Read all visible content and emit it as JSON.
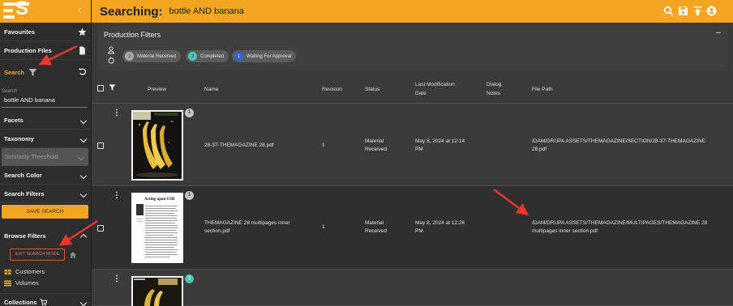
{
  "app": {
    "logo_text": "ES",
    "collapse_glyph": "‹"
  },
  "header": {
    "title": "Searching:",
    "query": "bottle AND banana",
    "icons": [
      "search-icon",
      "save-icon",
      "upload-icon",
      "user-icon"
    ]
  },
  "sidebar": {
    "favourites": "Favourites",
    "production_files": "Production Files",
    "search": "Search",
    "search_field_label": "Search",
    "search_value": "bottle AND banana",
    "facets": "Facets",
    "taxonomy": "Taxonomy",
    "similarity_threshold": "Similarity Threshold",
    "search_color": "Search Color",
    "search_filters": "Search Filters",
    "save_search": "SAVE SEARCH",
    "browse_filters": "Browse Filters",
    "exit_search_mode": "EXIT SEARCH MODE",
    "browse_items": [
      "Customers",
      "Volumes"
    ],
    "collections": "Collections"
  },
  "filters": {
    "title": "Production Filters",
    "collapse_glyph": "−",
    "chips": [
      {
        "count": "2",
        "label": "Material Received"
      },
      {
        "count": "3",
        "label": "Completed"
      },
      {
        "count": "1",
        "label": "Waiting For Approval"
      }
    ]
  },
  "table": {
    "columns": {
      "preview": "Preview",
      "name": "Name",
      "revision": "Revision",
      "status": "Status",
      "modified_1": "Last Modification",
      "modified_2": "Date",
      "notes_1": "Dialog",
      "notes_2": "Notes",
      "path": "File Path"
    },
    "rows": [
      {
        "badge": "1",
        "name": "28-37-THEMAGAZINE 28.pdf",
        "revision": "1",
        "status_1": "Material",
        "status_2": "Received",
        "date_1": "May 8, 2024 at 12:14",
        "date_2": "PM",
        "path_1": "/DAM/DRUPA ASSETS/THEMAGAZINE/SECTION/28-37-THEMAGAZINE",
        "path_2": "28.pdf"
      },
      {
        "badge": "1",
        "thumb_title": "Acting upon CSR",
        "name_1": "THEMAGAZINE 28 multipages inner",
        "name_2": "section.pdf",
        "revision": "1",
        "status_1": "Material",
        "status_2": "Received",
        "date_1": "May 8, 2024 at 12:26",
        "date_2": "PM",
        "path_1": "/DAM/DRUPA ASSETS/THEMAGAZINE/MULTIPAGES/THEMAGAZINE 28",
        "path_2": "multipages inner section.pdf"
      },
      {
        "badge": "1"
      }
    ]
  },
  "colors": {
    "accent": "#f4a623",
    "sidebar_bg": "#2d2d2d",
    "content_bg": "#3a3a3a",
    "annotation_arrow": "#e8372a",
    "completed": "#4fc2b6",
    "waiting": "#2e64d4"
  }
}
